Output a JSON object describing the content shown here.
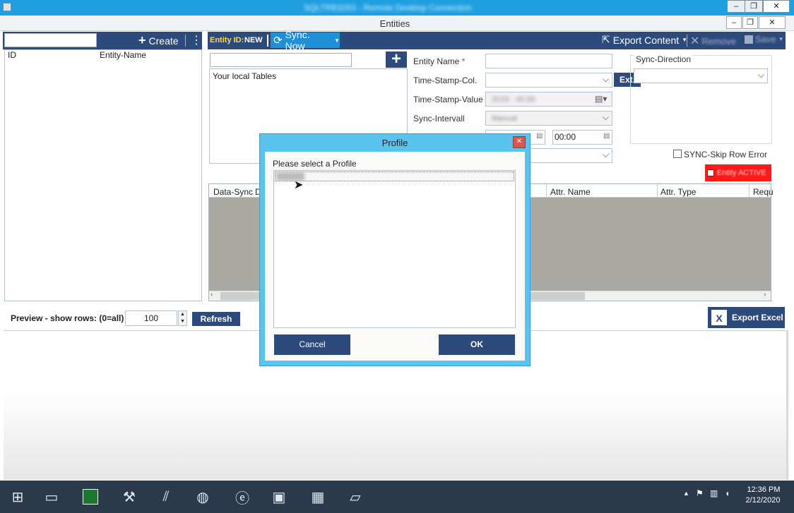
{
  "rdp": {
    "title": "SQLTRB3263 - Remote Desktop Connection"
  },
  "app": {
    "title": "Entities"
  },
  "toolbar": {
    "create_label": "Create",
    "entity_id_label": "Entity ID:",
    "entity_id_value": "NEW",
    "sync_now_label": "Sync. Now",
    "export_content_label": "Export Content",
    "remove_label": "Remove",
    "save_label": "Save"
  },
  "entity_list": {
    "columns": [
      "ID",
      "Entity-Name"
    ]
  },
  "tables": {
    "header": "Your local Tables"
  },
  "form": {
    "entity_name_label": "Entity Name",
    "required_mark": "*",
    "timestamp_col_label": "Time-Stamp-Col.",
    "timestamp_value_label": "Time-Stamp-Value",
    "sync_interval_label": "Sync-Intervall",
    "time_value": "00:00",
    "ext_label": "Ext.",
    "sync_direction_label": "Sync-Direction",
    "skip_row_error_label": "SYNC-Skip Row Error",
    "entity_active_label": "Entity ACTIVE"
  },
  "attr_grid": {
    "columns": [
      "Data-Sync",
      "D",
      "Attr. Name",
      "Attr. Type",
      "Requ"
    ]
  },
  "preview": {
    "label": "Preview - show rows: (0=all)",
    "rows_value": "100",
    "refresh_label": "Refresh",
    "export_excel_label": "Export Excel"
  },
  "dialog": {
    "title": "Profile",
    "prompt": "Please select a Profile",
    "cancel_label": "Cancel",
    "ok_label": "OK"
  },
  "taskbar": {
    "time": "12:36 PM",
    "date": "2/12/2020"
  },
  "colors": {
    "navy": "#2d4a7c",
    "accent_blue": "#1f8fd8",
    "active_red": "#ff1a1a"
  }
}
